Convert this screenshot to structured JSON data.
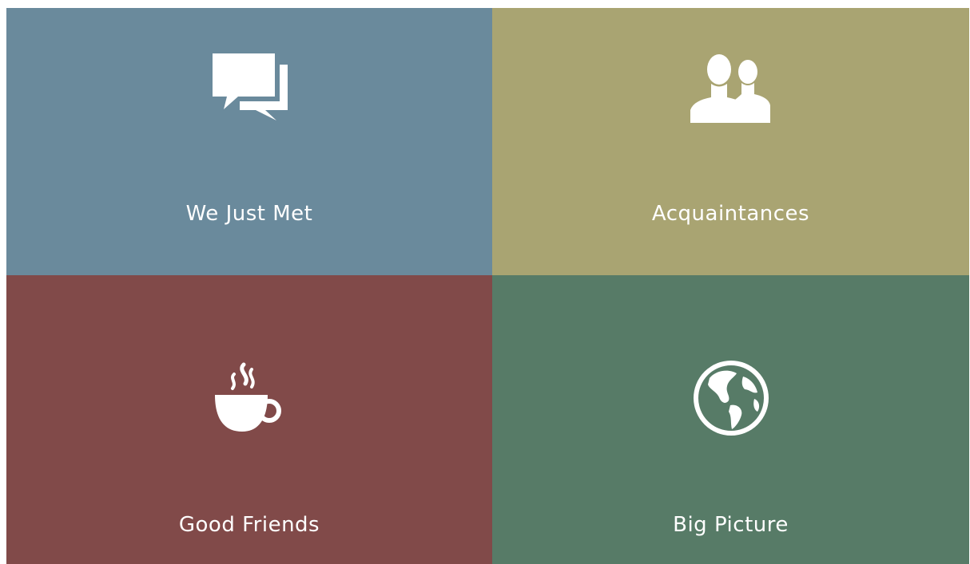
{
  "tiles": [
    {
      "label": "We Just Met",
      "icon": "chat-bubbles-icon",
      "color": "#6A8A9C"
    },
    {
      "label": "Acquaintances",
      "icon": "people-icon",
      "color": "#A9A472"
    },
    {
      "label": "Good Friends",
      "icon": "coffee-cup-icon",
      "color": "#814A49"
    },
    {
      "label": "Big Picture",
      "icon": "globe-icon",
      "color": "#577B67"
    }
  ]
}
